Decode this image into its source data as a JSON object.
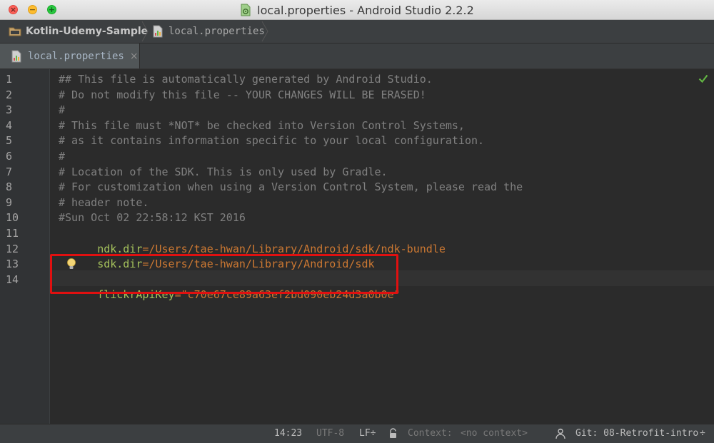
{
  "window": {
    "title": "local.properties - Android Studio 2.2.2",
    "close_glyph": "×",
    "minimize_glyph": "−",
    "maximize_glyph": "+"
  },
  "breadcrumb": {
    "project": "Kotlin-Udemy-Sample",
    "file": "local.properties"
  },
  "tabs": [
    {
      "label": "local.properties",
      "close_glyph": "×",
      "active": true
    }
  ],
  "editor": {
    "line_numbers": [
      "1",
      "2",
      "3",
      "4",
      "5",
      "6",
      "7",
      "8",
      "9",
      "10",
      "11",
      "12",
      "13",
      "14"
    ],
    "lines": [
      {
        "comment": "## This file is automatically generated by Android Studio."
      },
      {
        "comment": "# Do not modify this file -- YOUR CHANGES WILL BE ERASED!"
      },
      {
        "comment": "#"
      },
      {
        "comment": "# This file must *NOT* be checked into Version Control Systems,"
      },
      {
        "comment": "# as it contains information specific to your local configuration."
      },
      {
        "comment": "#"
      },
      {
        "comment": "# Location of the SDK. This is only used by Gradle."
      },
      {
        "comment": "# For customization when using a Version Control System, please read the"
      },
      {
        "comment": "# header note."
      },
      {
        "comment": "#Sun Oct 02 22:58:12 KST 2016"
      },
      {
        "key": "ndk.dir",
        "eq": "=",
        "value": "/Users/tae-hwan/Library/Android/sdk/ndk-bundle"
      },
      {
        "key": "sdk.dir",
        "eq": "=",
        "value": "/Users/tae-hwan/Library/Android/sdk"
      },
      {
        "comment": ""
      },
      {
        "key": "flickrApiKey",
        "eq": "=",
        "value": "\"c70e67ce89a63ef2bd090eb24d3a0b0e\""
      }
    ]
  },
  "status": {
    "position": "14:23",
    "encoding": "UTF-8",
    "line_ending": "LF÷",
    "context_label": "Context:",
    "context_value": "<no context>",
    "git_branch": "Git: 08-Retrofit-intro",
    "git_chevron": "÷"
  },
  "colors": {
    "editor_bg": "#2b2b2b",
    "comment": "#808080",
    "key": "#a5c25c",
    "value": "#cc7832",
    "highlight_box": "#e01010"
  }
}
